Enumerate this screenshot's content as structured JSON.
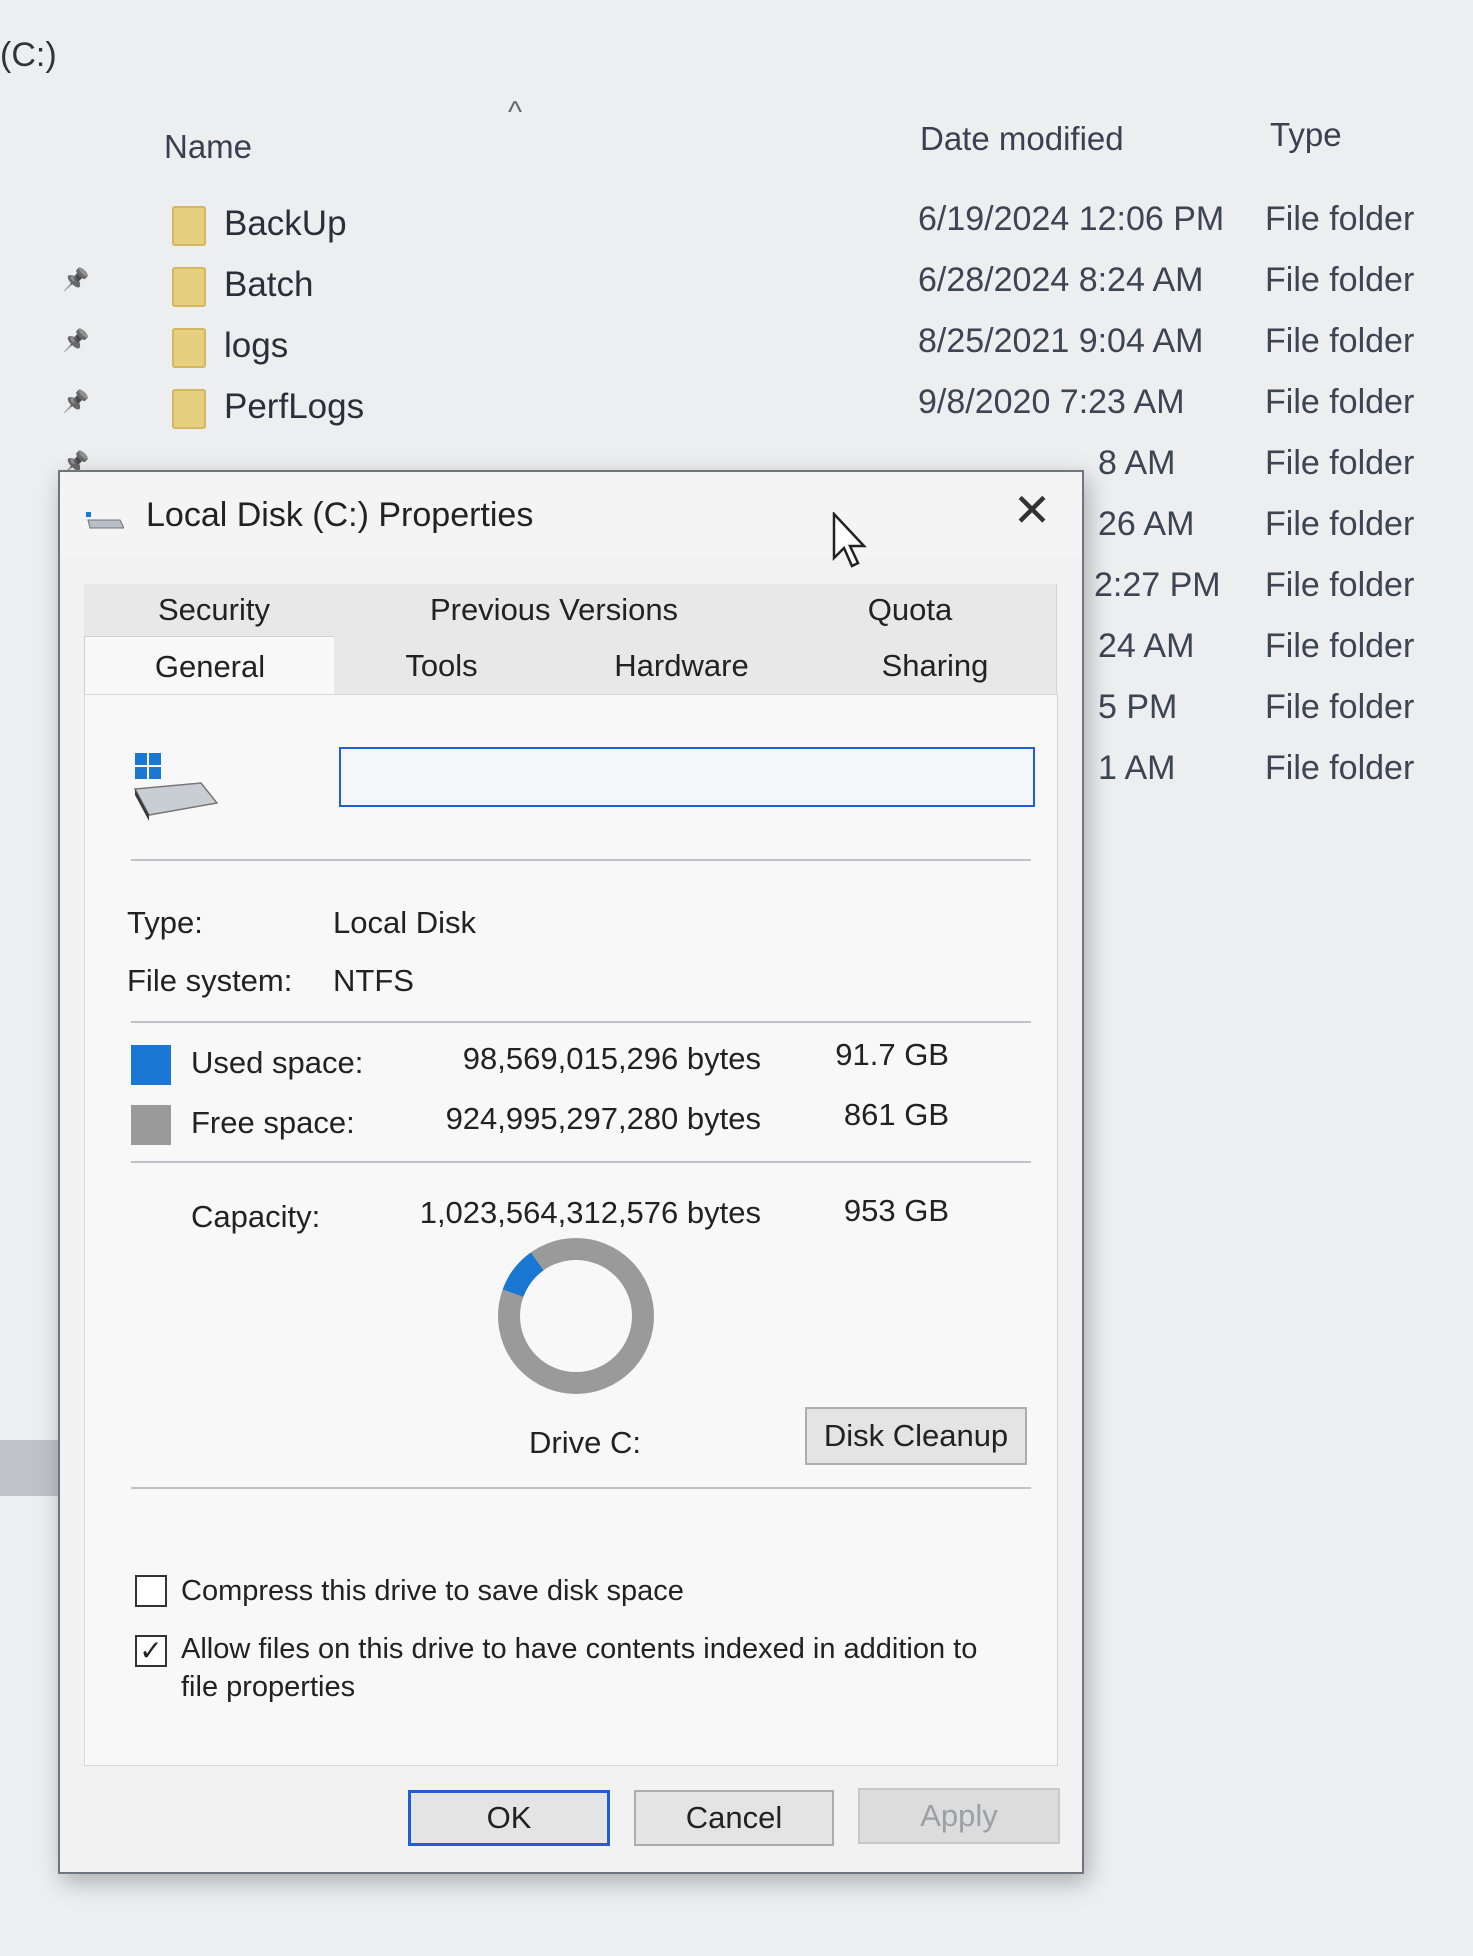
{
  "explorer": {
    "title": "(C:)",
    "columns": {
      "name": "Name",
      "date": "Date modified",
      "type": "Type"
    },
    "rows": [
      {
        "name": "BackUp",
        "date": "6/19/2024 12:06 PM",
        "type": "File folder"
      },
      {
        "name": "Batch",
        "date": "6/28/2024 8:24 AM",
        "type": "File folder"
      },
      {
        "name": "logs",
        "date": "8/25/2021 9:04 AM",
        "type": "File folder"
      },
      {
        "name": "PerfLogs",
        "date": "9/8/2020 7:23 AM",
        "type": "File folder"
      },
      {
        "name": "",
        "date": "8 AM",
        "type": "File folder"
      },
      {
        "name": "",
        "date": "26 AM",
        "type": "File folder"
      },
      {
        "name": "",
        "date": "2:27 PM",
        "type": "File folder"
      },
      {
        "name": "",
        "date": "24 AM",
        "type": "File folder"
      },
      {
        "name": "",
        "date": "5 PM",
        "type": "File folder"
      },
      {
        "name": "",
        "date": "1 AM",
        "type": "File folder"
      }
    ]
  },
  "dialog": {
    "title": "Local Disk (C:) Properties",
    "close": "✕",
    "tabs_row1": [
      "Security",
      "Previous Versions",
      "Quota"
    ],
    "tabs_row2": [
      "General",
      "Tools",
      "Hardware",
      "Sharing"
    ],
    "active_tab": "General",
    "drive_name": "",
    "type_label": "Type:",
    "type_value": "Local Disk",
    "fs_label": "File system:",
    "fs_value": "NTFS",
    "used_label": "Used space:",
    "used_bytes": "98,569,015,296 bytes",
    "used_gb": "91.7 GB",
    "free_label": "Free space:",
    "free_bytes": "924,995,297,280 bytes",
    "free_gb": "861 GB",
    "capacity_label": "Capacity:",
    "capacity_bytes": "1,023,564,312,576 bytes",
    "capacity_gb": "953 GB",
    "drive_caption": "Drive C:",
    "disk_cleanup": "Disk Cleanup",
    "compress_label": "Compress this drive to save disk space",
    "compress_checked": false,
    "index_label_line1": "Allow files on this drive to have contents indexed in addition to",
    "index_label_line2": "file properties",
    "index_checked": true,
    "ok": "OK",
    "cancel": "Cancel",
    "apply": "Apply",
    "used_fraction": 0.096,
    "colors": {
      "used": "#1a78d4",
      "free": "#9a9a9a",
      "focus": "#1f5fd6"
    }
  }
}
